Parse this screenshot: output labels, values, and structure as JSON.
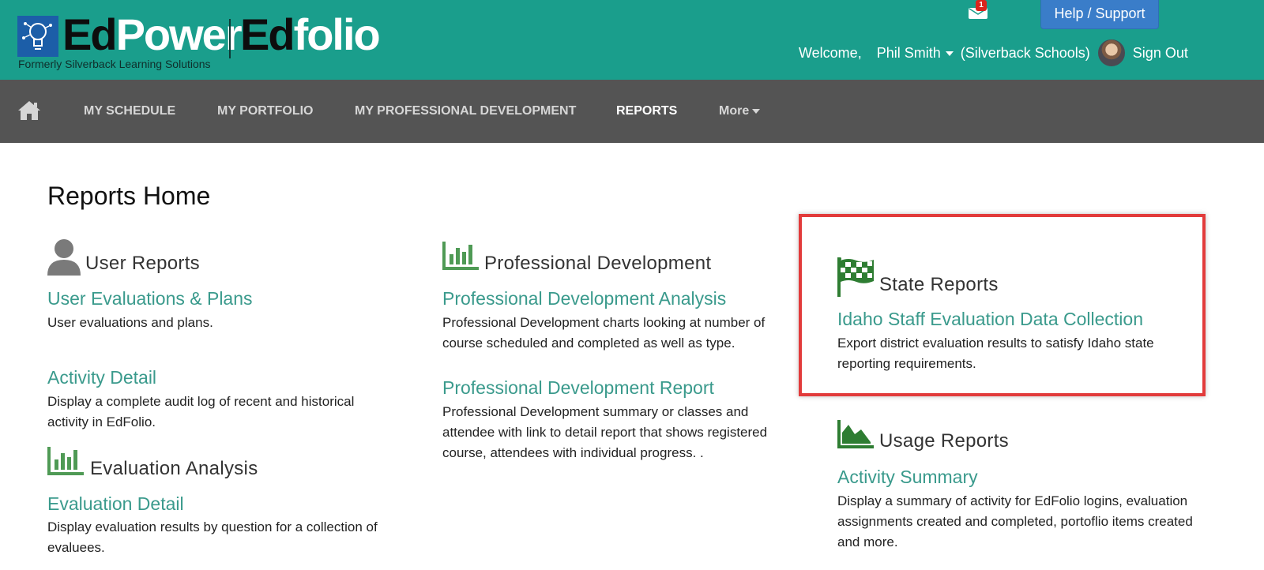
{
  "header": {
    "logo_ed": "Ed",
    "logo_power": "Power",
    "logo_ed2": "Ed",
    "logo_folio": "folio",
    "logo_tagline": "Formerly Silverback Learning Solutions",
    "mail_badge": "1",
    "help_label": "Help / Support",
    "welcome": "Welcome,",
    "user_name": "Phil Smith",
    "organization": "(Silverback Schools)",
    "sign_out": "Sign Out"
  },
  "nav": {
    "items": [
      {
        "label": "MY SCHEDULE"
      },
      {
        "label": "MY PORTFOLIO"
      },
      {
        "label": "MY PROFESSIONAL DEVELOPMENT"
      },
      {
        "label": "REPORTS"
      },
      {
        "label": "More"
      }
    ]
  },
  "main": {
    "title": "Reports Home",
    "sections": {
      "user_reports": {
        "title": "User Reports",
        "icon": "user-icon",
        "reports": [
          {
            "label": "User Evaluations & Plans",
            "desc": "User evaluations and plans."
          },
          {
            "label": "Activity Detail",
            "desc": "Display a complete audit log of recent and historical activity in EdFolio."
          }
        ]
      },
      "evaluation_analysis": {
        "title": "Evaluation Analysis",
        "icon": "bar-chart-icon",
        "reports": [
          {
            "label": "Evaluation Detail",
            "desc": "Display evaluation results by question for a collection of evaluees."
          }
        ]
      },
      "professional_development": {
        "title": "Professional Development",
        "icon": "bar-chart-icon",
        "reports": [
          {
            "label": "Professional Development Analysis",
            "desc": "Professional Development charts looking at number of course scheduled and completed as well as type."
          },
          {
            "label": "Professional Development Report",
            "desc": "Professional Development summary or classes and attendee with link to detail report that shows registered course, attendees with individual progress. ."
          }
        ]
      },
      "state_reports": {
        "title": "State Reports",
        "icon": "checkered-flag-icon",
        "reports": [
          {
            "label": "Idaho Staff Evaluation Data Collection",
            "desc": "Export district evaluation results to satisfy Idaho state reporting requirements."
          }
        ]
      },
      "usage_reports": {
        "title": "Usage Reports",
        "icon": "area-chart-icon",
        "reports": [
          {
            "label": "Activity Summary",
            "desc": "Display a summary of activity for EdFolio logins, evaluation assignments created and completed, portoflio items created and more."
          }
        ]
      }
    }
  },
  "colors": {
    "header_bg": "#1a9e8c",
    "nav_bg": "#545454",
    "link": "#3a9a8c",
    "icon_green": "#4f9a55",
    "flag_green": "#2e7d32",
    "highlight": "#e23b3b",
    "help_button": "#3a7dc9"
  }
}
